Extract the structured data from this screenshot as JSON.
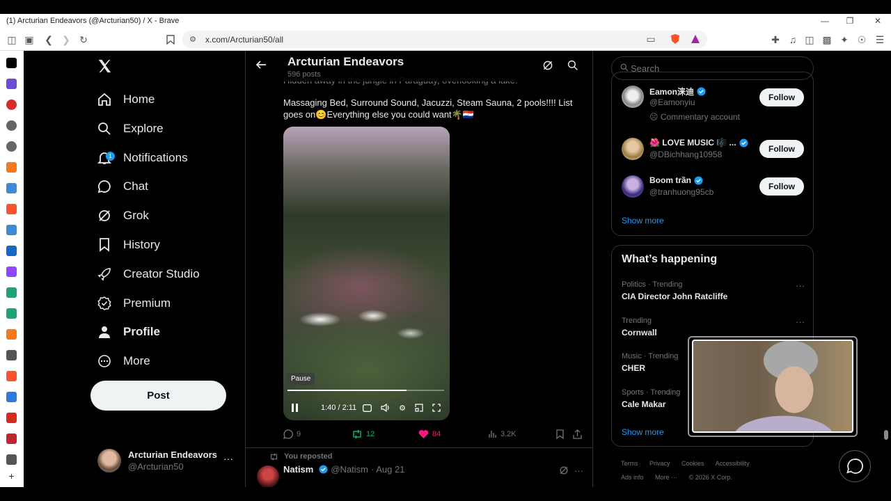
{
  "window": {
    "title": "(1) Arcturian Endeavors (@Arcturian50) / X - Brave",
    "url": "x.com/Arcturian50/all"
  },
  "nav": {
    "items": [
      {
        "label": "Home",
        "icon": "home-icon"
      },
      {
        "label": "Explore",
        "icon": "search-icon"
      },
      {
        "label": "Notifications",
        "icon": "bell-icon",
        "badge": "1"
      },
      {
        "label": "Chat",
        "icon": "chat-icon"
      },
      {
        "label": "Grok",
        "icon": "grok-icon"
      },
      {
        "label": "History",
        "icon": "bookmark-icon"
      },
      {
        "label": "Creator Studio",
        "icon": "rocket-icon"
      },
      {
        "label": "Premium",
        "icon": "verified-icon"
      },
      {
        "label": "Profile",
        "icon": "person-icon"
      },
      {
        "label": "More",
        "icon": "more-circle-icon"
      }
    ],
    "post_label": "Post",
    "account": {
      "name": "Arcturian Endeavors",
      "handle": "@Arcturian50"
    }
  },
  "header": {
    "title": "Arcturian Endeavors",
    "subtitle": "596 posts"
  },
  "tweet": {
    "cut_text": "Hidden away in the jungle in Paraguay, overlooking a lake.",
    "text": "Massaging Bed, Surround Sound, Jacuzzi, Steam Sauna, 2 pools!!!! List goes on😊Everything else you could want🌴🇵🇾",
    "video": {
      "tooltip": "Pause",
      "time": "1:40 / 2:11",
      "progress": 0.76
    },
    "stats": {
      "replies": "9",
      "reposts": "12",
      "likes": "84",
      "views": "3.2K"
    }
  },
  "next_tweet": {
    "repost_label": "You reposted",
    "name": "Natism",
    "handle": "@Natism",
    "date": "· Aug 21"
  },
  "search": {
    "placeholder": "Search"
  },
  "who_to_follow": {
    "items": [
      {
        "name": "Eamon涞迪",
        "handle": "@Eamonyiu",
        "extra": "Commentary account"
      },
      {
        "name": "🌺 LOVE MUSIC 🎼 ...",
        "handle": "@DBichhang10958",
        "extra": ""
      },
      {
        "name": "Boom trần",
        "handle": "@tranhuong95cb",
        "extra": ""
      }
    ],
    "follow_label": "Follow",
    "show_more": "Show more"
  },
  "whats_happening": {
    "title": "What’s happening",
    "trends": [
      {
        "category": "Politics · Trending",
        "name": "CIA Director John Ratcliffe"
      },
      {
        "category": "Trending",
        "name": "Cornwall"
      },
      {
        "category": "Music · Trending",
        "name": "CHER"
      },
      {
        "category": "Sports · Trending",
        "name": "Cale Makar"
      }
    ],
    "show_more": "Show more"
  },
  "footer": {
    "links": [
      "Terms",
      "Privacy",
      "Cookies",
      "Accessibility"
    ],
    "links2": [
      "Ads info",
      "More ···",
      "© 2026 X Corp."
    ]
  },
  "colors": {
    "accent": "#1d9bf0",
    "like": "#f91880",
    "repost": "#00ba7c"
  }
}
